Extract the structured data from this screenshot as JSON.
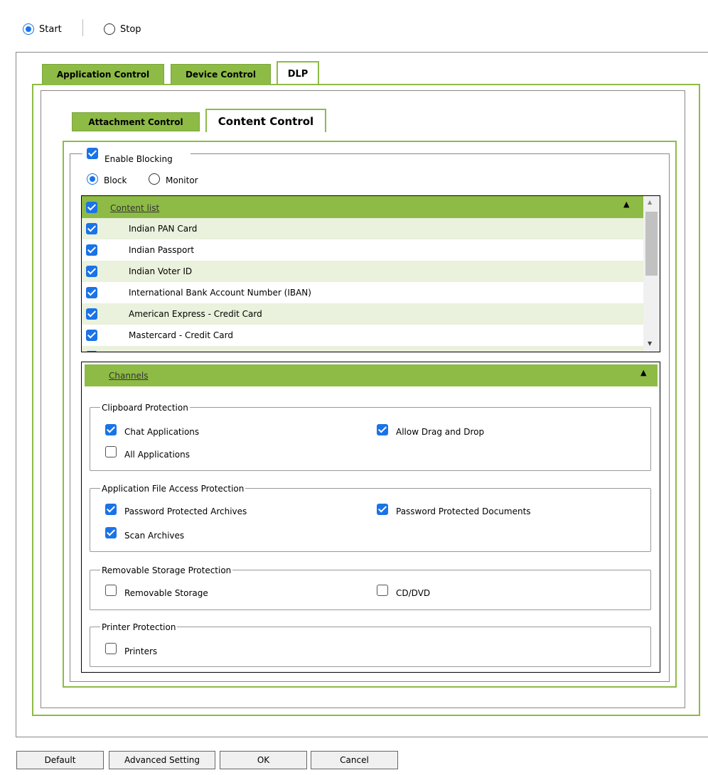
{
  "status_radio": [
    {
      "label": "Start",
      "selected": true
    },
    {
      "label": "Stop",
      "selected": false
    }
  ],
  "main_tabs": [
    "Application Control",
    "Device Control",
    "DLP"
  ],
  "sub_tabs": [
    "Attachment Control",
    "Content Control"
  ],
  "enable_blocking": {
    "label": "Enable Blocking",
    "checked": true
  },
  "mode_radio": [
    {
      "label": "Block",
      "selected": true
    },
    {
      "label": "Monitor",
      "selected": false
    }
  ],
  "content_list": {
    "header": "Content list",
    "items": [
      {
        "label": "Indian PAN Card",
        "checked": true
      },
      {
        "label": "Indian Passport",
        "checked": true
      },
      {
        "label": "Indian Voter ID",
        "checked": true
      },
      {
        "label": "International Bank Account Number (IBAN)",
        "checked": true
      },
      {
        "label": "American Express - Credit Card",
        "checked": true
      },
      {
        "label": "Mastercard - Credit Card",
        "checked": true
      }
    ]
  },
  "channels": {
    "header": "Channels",
    "clipboard": {
      "legend": "Clipboard Protection",
      "chat": "Chat Applications",
      "drag_drop": "Allow Drag and Drop",
      "all_apps": "All Applications"
    },
    "file_access": {
      "legend": "Application File Access Protection",
      "pwd_archives": "Password Protected Archives",
      "pwd_docs": "Password Protected Documents",
      "scan_archives": "Scan Archives"
    },
    "removable": {
      "legend": "Removable Storage Protection",
      "removable_storage": "Removable Storage",
      "cd_dvd": "CD/DVD"
    },
    "printer": {
      "legend": "Printer Protection",
      "printers": "Printers"
    }
  },
  "buttons": {
    "default": "Default",
    "advanced": "Advanced Setting",
    "ok": "OK",
    "cancel": "Cancel"
  },
  "colors": {
    "accent_green": "#8dbb45",
    "row_green": "#eaf1dc",
    "check_blue": "#1a73e8"
  }
}
